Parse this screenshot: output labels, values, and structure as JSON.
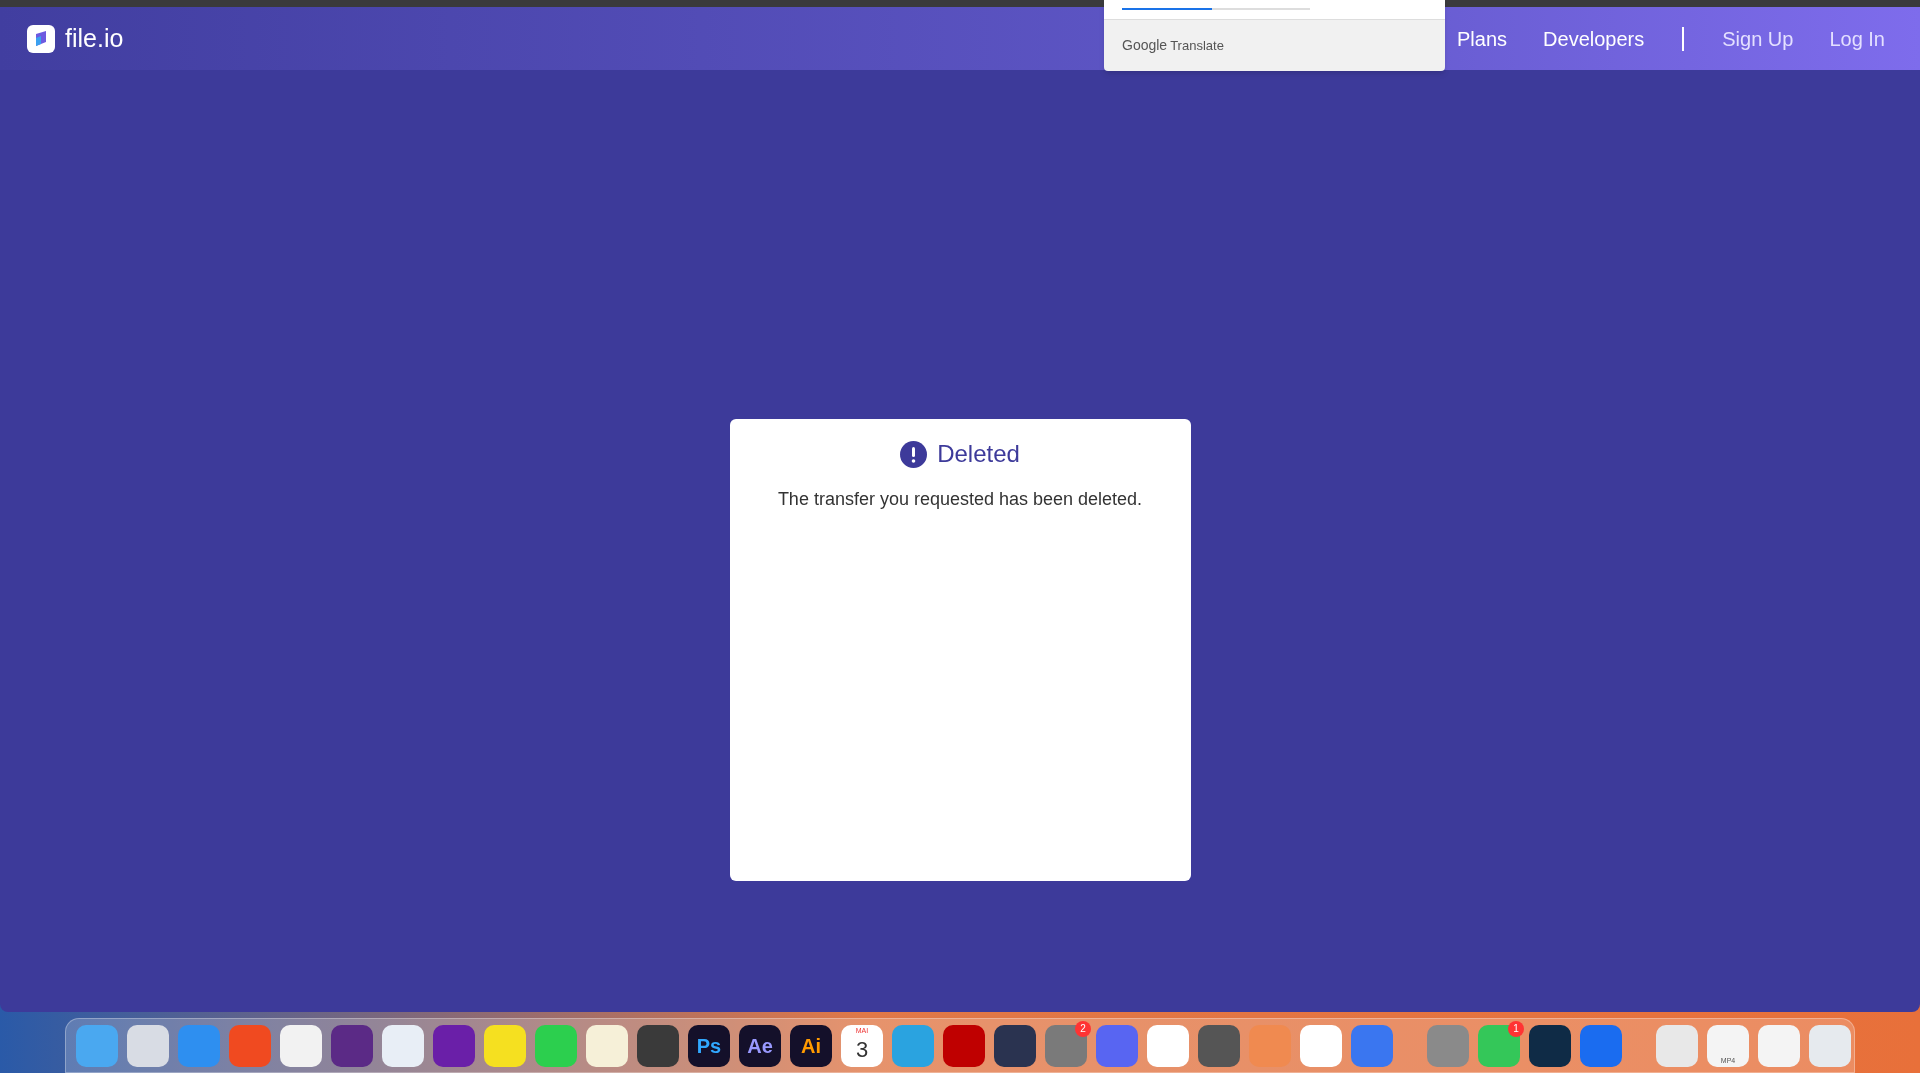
{
  "header": {
    "logo": "file.io",
    "nav_primary": [
      "Plans",
      "Developers"
    ],
    "nav_account": [
      "Sign Up",
      "Log In"
    ]
  },
  "translate_popup": {
    "level": 0.48,
    "brand": "Google",
    "product": "Translate"
  },
  "card": {
    "title": "Deleted",
    "message": "The transfer you requested has been deleted."
  },
  "dock": {
    "items": [
      {
        "kind": "app",
        "color": "#4aa8f0"
      },
      {
        "kind": "app",
        "color": "#d8dce4"
      },
      {
        "kind": "app",
        "color": "#2e8ff0"
      },
      {
        "kind": "app",
        "color": "#f04a20"
      },
      {
        "kind": "app",
        "color": "#f2f2f2"
      },
      {
        "kind": "app",
        "color": "#5b2a86"
      },
      {
        "kind": "app",
        "color": "#e8eef6"
      },
      {
        "kind": "app",
        "color": "#6a1fa8"
      },
      {
        "kind": "app",
        "color": "#f5e020"
      },
      {
        "kind": "app",
        "color": "#2ccf4e"
      },
      {
        "kind": "app",
        "color": "#f6f0d8"
      },
      {
        "kind": "app",
        "color": "#3a3a3a"
      },
      {
        "kind": "lettered",
        "color": "#31a8ff",
        "label": "Ps"
      },
      {
        "kind": "lettered",
        "color": "#9999ff",
        "label": "Ae"
      },
      {
        "kind": "lettered",
        "color": "#ff9a00",
        "label": "Ai"
      },
      {
        "kind": "calendar",
        "color": "#ffffff",
        "month": "MAI",
        "day": "3"
      },
      {
        "kind": "app",
        "color": "#2aa3e0"
      },
      {
        "kind": "app",
        "color": "#bf0000"
      },
      {
        "kind": "app",
        "color": "#2a3350"
      },
      {
        "kind": "app",
        "color": "#7a7a7a",
        "badge": "2"
      },
      {
        "kind": "app",
        "color": "#5865f2"
      },
      {
        "kind": "app",
        "color": "#ffffff"
      },
      {
        "kind": "app",
        "color": "#555555"
      },
      {
        "kind": "app",
        "color": "#f08a50"
      },
      {
        "kind": "app",
        "color": "#ffffff"
      },
      {
        "kind": "app",
        "color": "#3a76f0"
      },
      {
        "kind": "separator"
      },
      {
        "kind": "app",
        "color": "#8a8a8a"
      },
      {
        "kind": "app",
        "color": "#34c759",
        "badge": "1"
      },
      {
        "kind": "app",
        "color": "#0f2b46"
      },
      {
        "kind": "app",
        "color": "#1a6cf0"
      },
      {
        "kind": "separator"
      },
      {
        "kind": "app",
        "color": "#e8e8e8"
      },
      {
        "kind": "file",
        "color": "#f4f4f4",
        "label": "MP4"
      },
      {
        "kind": "app",
        "color": "#f4f4f4"
      },
      {
        "kind": "app",
        "color": "#e6eaee"
      }
    ]
  }
}
